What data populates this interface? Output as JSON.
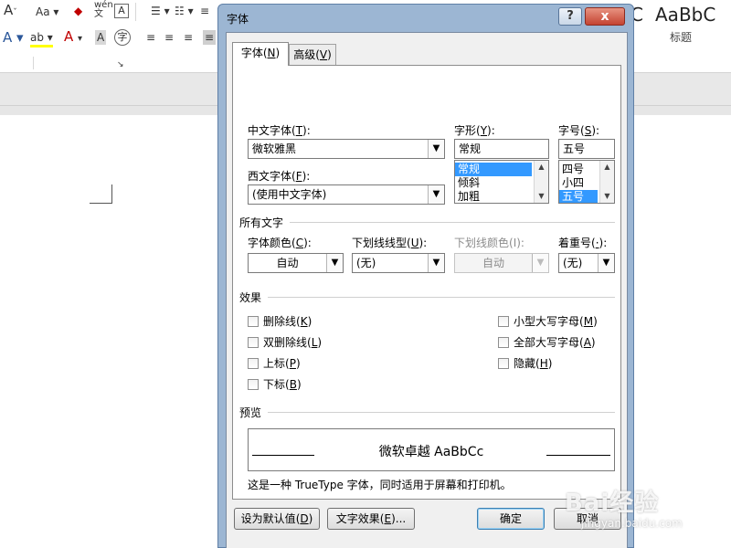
{
  "word": {
    "ribbon": {
      "font_size_dd": "Aa",
      "pinyin": "wén",
      "style_sample_1": "C",
      "style_sample_2": "AaBbC",
      "style_caption": "标题"
    }
  },
  "dialog": {
    "title": "字体",
    "help_label": "?",
    "close_label": "x",
    "tabs": [
      {
        "label": "字体",
        "key": "N"
      },
      {
        "label": "高级",
        "key": "V"
      }
    ],
    "chinese_font": {
      "label": "中文字体",
      "key": "T",
      "value": "微软雅黑"
    },
    "western_font": {
      "label": "西文字体",
      "key": "F",
      "value": "(使用中文字体)"
    },
    "font_style": {
      "label": "字形",
      "key": "Y",
      "value": "常规",
      "options": [
        "常规",
        "倾斜",
        "加粗"
      ],
      "selected": "常规"
    },
    "font_size": {
      "label": "字号",
      "key": "S",
      "value": "五号",
      "options": [
        "四号",
        "小四",
        "五号"
      ],
      "selected": "五号"
    },
    "all_text": {
      "title": "所有文字",
      "font_color": {
        "label": "字体颜色",
        "key": "C",
        "value": "自动"
      },
      "underline_style": {
        "label": "下划线线型",
        "key": "U",
        "value": "(无)"
      },
      "underline_color": {
        "label": "下划线颜色",
        "key": "I",
        "value": "自动"
      },
      "emphasis": {
        "label": "着重号",
        "key": "·",
        "value": "(无)"
      }
    },
    "effects": {
      "title": "效果",
      "left": [
        {
          "label": "删除线",
          "key": "K",
          "checked": false
        },
        {
          "label": "双删除线",
          "key": "L",
          "checked": false
        },
        {
          "label": "上标",
          "key": "P",
          "checked": false
        },
        {
          "label": "下标",
          "key": "B",
          "checked": false
        }
      ],
      "right": [
        {
          "label": "小型大写字母",
          "key": "M",
          "checked": false
        },
        {
          "label": "全部大写字母",
          "key": "A",
          "checked": false
        },
        {
          "label": "隐藏",
          "key": "H",
          "checked": false
        }
      ]
    },
    "preview": {
      "title": "预览",
      "sample": "微软卓越  AaBbCc",
      "note": "这是一种 TrueType 字体，同时适用于屏幕和打印机。"
    },
    "buttons": {
      "set_default": {
        "label": "设为默认值",
        "key": "D"
      },
      "text_effects": {
        "label": "文字效果",
        "key": "E",
        "suffix": "..."
      },
      "ok": "确定",
      "cancel": "取消"
    }
  },
  "watermark": {
    "logo": "Bai经验",
    "sub": "jingyan.baidu.com"
  }
}
